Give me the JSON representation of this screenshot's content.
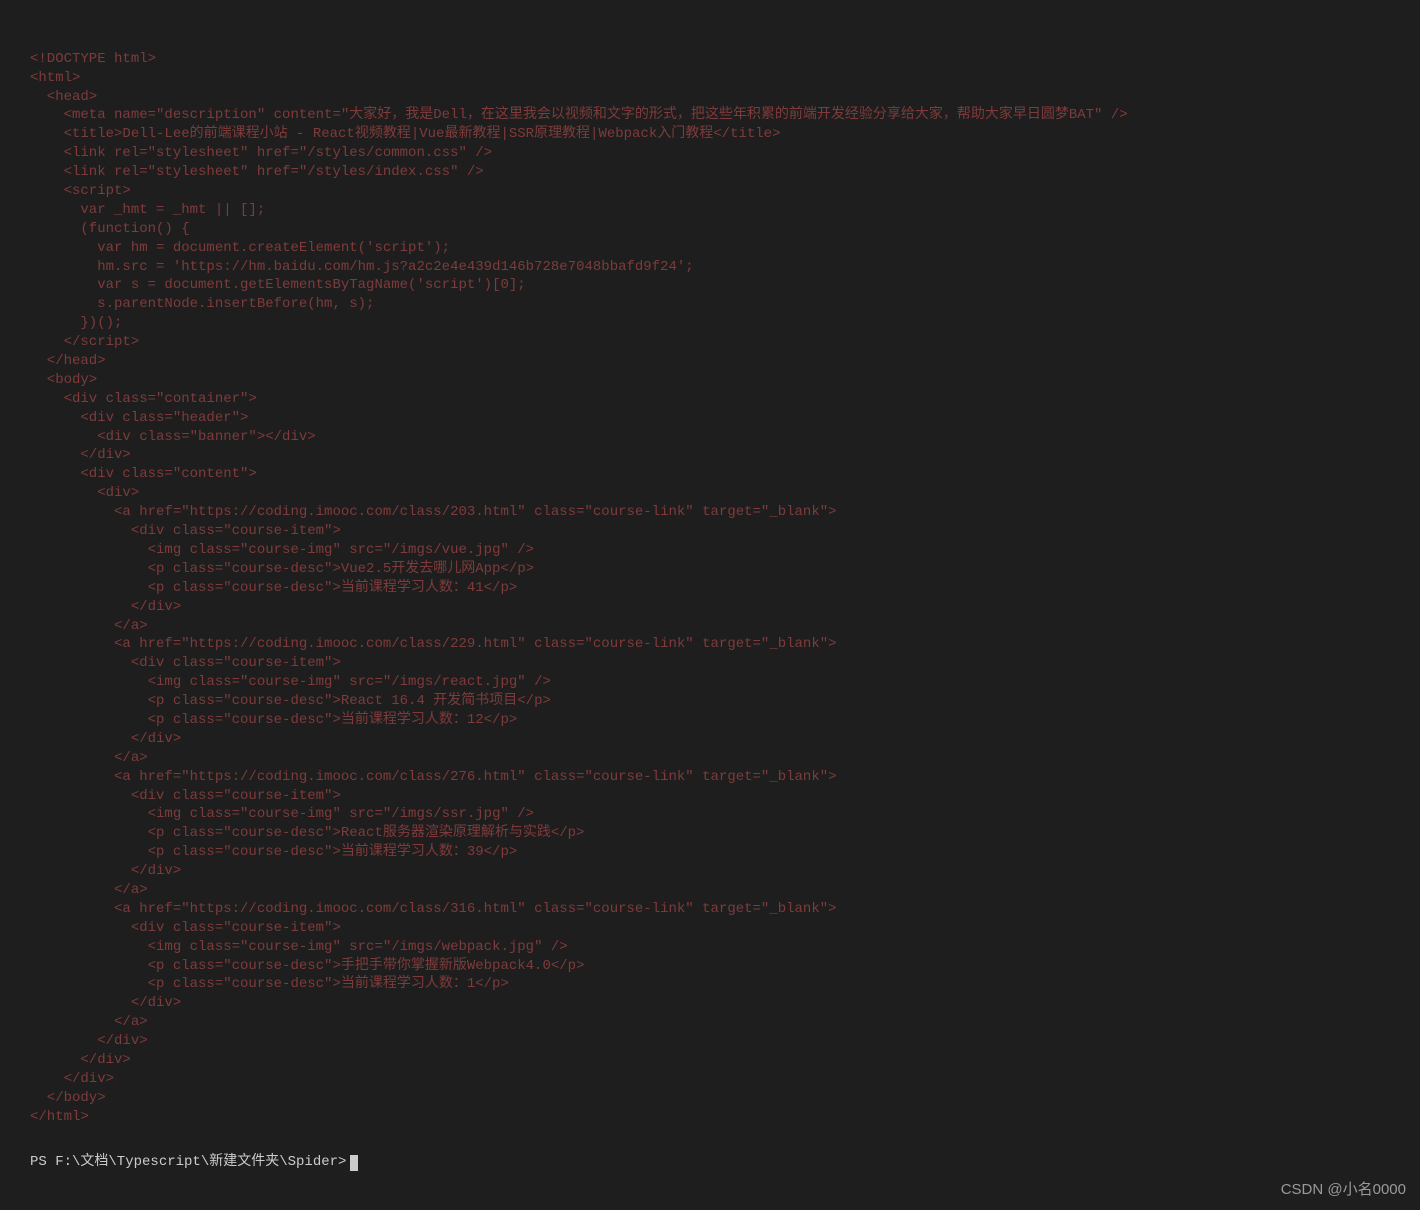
{
  "code": {
    "lines": [
      "<!DOCTYPE html>",
      "<html>",
      "  <head>",
      "    <meta name=\"description\" content=\"大家好，我是Dell，在这里我会以视频和文字的形式，把这些年积累的前端开发经验分享给大家，帮助大家早日圆梦BAT\" />",
      "    <title>Dell-Lee的前端课程小站 - React视频教程|Vue最新教程|SSR原理教程|Webpack入门教程</title>",
      "    <link rel=\"stylesheet\" href=\"/styles/common.css\" />",
      "    <link rel=\"stylesheet\" href=\"/styles/index.css\" />",
      "    <script>",
      "      var _hmt = _hmt || [];",
      "      (function() {",
      "        var hm = document.createElement('script');",
      "        hm.src = 'https://hm.baidu.com/hm.js?a2c2e4e439d146b728e7048bbafd9f24';",
      "        var s = document.getElementsByTagName('script')[0];",
      "        s.parentNode.insertBefore(hm, s);",
      "      })();",
      "    </script>",
      "  </head>",
      "  <body>",
      "    <div class=\"container\">",
      "      <div class=\"header\">",
      "        <div class=\"banner\"></div>",
      "      </div>",
      "      <div class=\"content\">",
      "        <div>",
      "          <a href=\"https://coding.imooc.com/class/203.html\" class=\"course-link\" target=\"_blank\">",
      "            <div class=\"course-item\">",
      "              <img class=\"course-img\" src=\"/imgs/vue.jpg\" />",
      "              <p class=\"course-desc\">Vue2.5开发去哪儿网App</p>",
      "              <p class=\"course-desc\">当前课程学习人数：41</p>",
      "            </div>",
      "          </a>",
      "          <a href=\"https://coding.imooc.com/class/229.html\" class=\"course-link\" target=\"_blank\">",
      "            <div class=\"course-item\">",
      "              <img class=\"course-img\" src=\"/imgs/react.jpg\" />",
      "              <p class=\"course-desc\">React 16.4 开发简书项目</p>",
      "              <p class=\"course-desc\">当前课程学习人数：12</p>",
      "            </div>",
      "          </a>",
      "          <a href=\"https://coding.imooc.com/class/276.html\" class=\"course-link\" target=\"_blank\">",
      "            <div class=\"course-item\">",
      "              <img class=\"course-img\" src=\"/imgs/ssr.jpg\" />",
      "              <p class=\"course-desc\">React服务器渲染原理解析与实践</p>",
      "              <p class=\"course-desc\">当前课程学习人数：39</p>",
      "            </div>",
      "          </a>",
      "          <a href=\"https://coding.imooc.com/class/316.html\" class=\"course-link\" target=\"_blank\">",
      "            <div class=\"course-item\">",
      "              <img class=\"course-img\" src=\"/imgs/webpack.jpg\" />",
      "              <p class=\"course-desc\">手把手带你掌握新版Webpack4.0</p>",
      "              <p class=\"course-desc\">当前课程学习人数：1</p>",
      "            </div>",
      "          </a>",
      "        </div>",
      "      </div>",
      "    </div>",
      "  </body>",
      "</html>"
    ]
  },
  "terminal": {
    "prompt": "PS F:\\文档\\Typescript\\新建文件夹\\Spider> "
  },
  "watermark": "CSDN @小名0000"
}
